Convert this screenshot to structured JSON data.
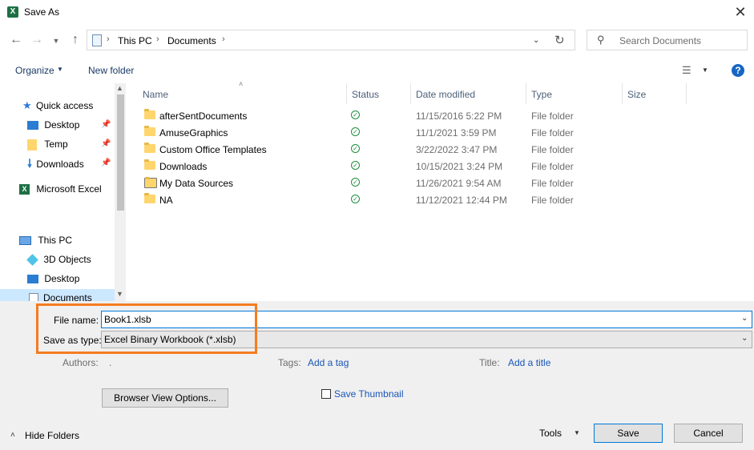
{
  "window": {
    "title": "Save As",
    "close_glyph": "✕",
    "app_icon": "excel-icon"
  },
  "address": {
    "crumbs": [
      "This PC",
      "Documents"
    ],
    "search_placeholder": "Search Documents"
  },
  "toolbar": {
    "organize": "Organize",
    "new_folder": "New folder",
    "help": "?"
  },
  "nav": {
    "quick_access": "Quick access",
    "items_quick": [
      {
        "label": "Desktop",
        "pinned": true
      },
      {
        "label": "Temp",
        "pinned": true
      },
      {
        "label": "Downloads",
        "pinned": true
      }
    ],
    "excel": "Microsoft Excel",
    "this_pc": "This PC",
    "items_pc": [
      "3D Objects",
      "Desktop",
      "Documents"
    ]
  },
  "columns": {
    "name": "Name",
    "status": "Status",
    "date": "Date modified",
    "type": "Type",
    "size": "Size"
  },
  "files": [
    {
      "name": "afterSentDocuments",
      "date": "11/15/2016 5:22 PM",
      "type": "File folder"
    },
    {
      "name": "AmuseGraphics",
      "date": "11/1/2021 3:59 PM",
      "type": "File folder"
    },
    {
      "name": "Custom Office Templates",
      "date": "3/22/2022 3:47 PM",
      "type": "File folder"
    },
    {
      "name": "Downloads",
      "date": "10/15/2021 3:24 PM",
      "type": "File folder"
    },
    {
      "name": "My Data Sources",
      "date": "11/26/2021 9:54 AM",
      "type": "File folder"
    },
    {
      "name": "NA",
      "date": "11/12/2021 12:44 PM",
      "type": "File folder"
    }
  ],
  "form": {
    "file_name_label": "File name:",
    "file_name_value": "Book1.xlsb",
    "save_type_label": "Save as type:",
    "save_type_value": "Excel Binary Workbook (*.xlsb)",
    "authors_label": "Authors:",
    "authors_value": ".",
    "tags_label": "Tags:",
    "tags_link": "Add a tag",
    "title_label": "Title:",
    "title_link": "Add a title",
    "browser_view": "Browser View Options...",
    "save_thumbnail": "Save Thumbnail",
    "hide_folders": "Hide Folders",
    "tools": "Tools",
    "save": "Save",
    "cancel": "Cancel"
  },
  "colors": {
    "highlight": "#f57c20",
    "accent": "#0078d7",
    "link": "#1a56b8"
  }
}
